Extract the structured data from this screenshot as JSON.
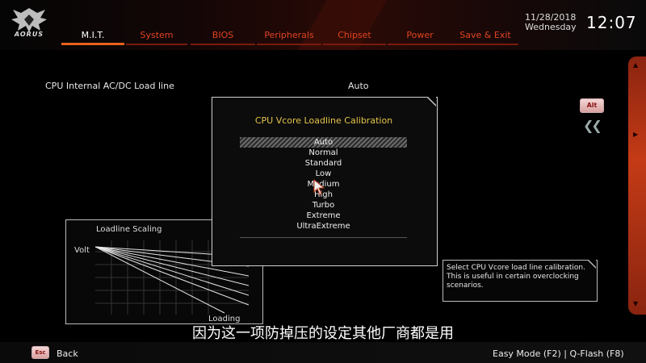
{
  "header": {
    "logo_text": "AORUS",
    "date": "11/28/2018",
    "weekday": "Wednesday",
    "time": "12:07",
    "tabs": [
      {
        "label": "M.I.T.",
        "active": true
      },
      {
        "label": "System",
        "active": false
      },
      {
        "label": "BIOS",
        "active": false
      },
      {
        "label": "Peripherals",
        "active": false
      },
      {
        "label": "Chipset",
        "active": false
      },
      {
        "label": "Power",
        "active": false
      },
      {
        "label": "Save & Exit",
        "active": false
      }
    ]
  },
  "main": {
    "setting_label": "CPU Internal AC/DC Load line",
    "setting_value": "Auto"
  },
  "graph": {
    "title": "Loadline Scaling",
    "y_label": "Volt",
    "x_label": "Loading"
  },
  "popup": {
    "title": "CPU Vcore Loadline Calibration",
    "selected_index": 0,
    "options": [
      "Auto",
      "Normal",
      "Standard",
      "Low",
      "Medium",
      "High",
      "Turbo",
      "Extreme",
      "UltraExtreme"
    ]
  },
  "side": {
    "alt_label": "Alt",
    "collapse_icon": "double-chevron-left-icon"
  },
  "help": {
    "text": "Select CPU Vcore load line calibration. This is useful in certain overclocking scenarios."
  },
  "subtitle": "因为这一项防掉压的设定其他厂商都是用",
  "footer": {
    "esc_key": "Esc",
    "back_label": "Back",
    "right_text": "Easy Mode (F2)  |  Q-Flash (F8)"
  },
  "colors": {
    "accent": "#e8621a",
    "tab_inactive": "#e0431f",
    "popup_title": "#e5c44a"
  }
}
